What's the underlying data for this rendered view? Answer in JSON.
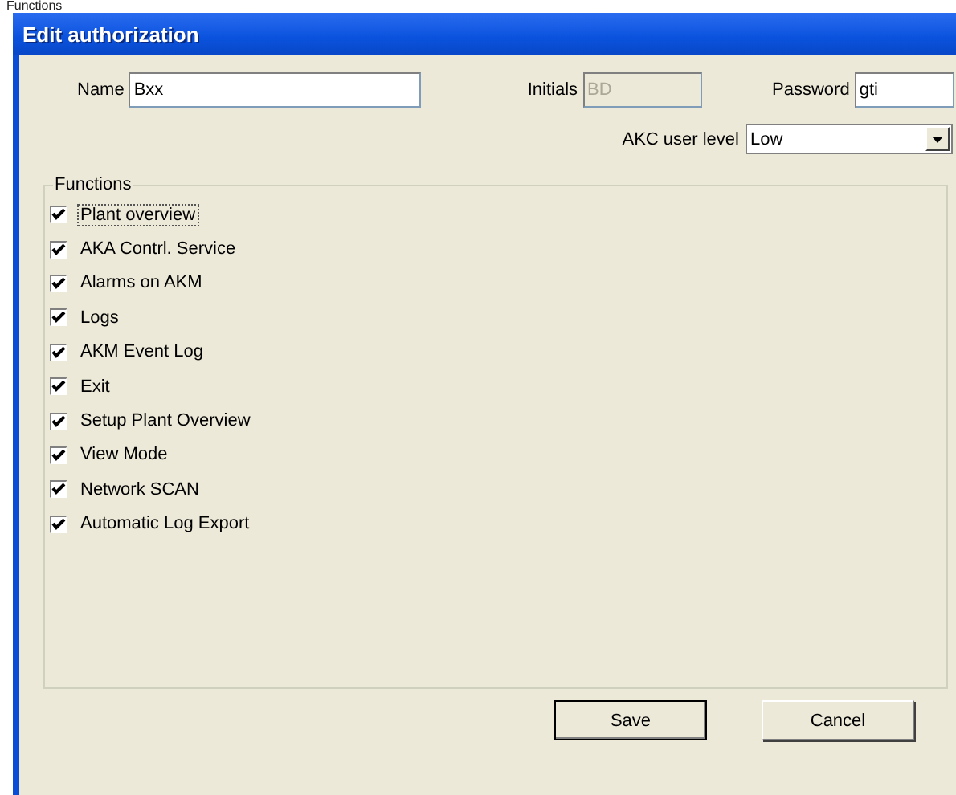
{
  "page_heading": "Functions",
  "window": {
    "title": "Edit authorization"
  },
  "fields": {
    "name": {
      "label": "Name",
      "value": "Bxx"
    },
    "initials": {
      "label": "Initials",
      "value": "BD",
      "disabled": true
    },
    "password": {
      "label": "Password",
      "value": "gti"
    },
    "user_level": {
      "label": "AKC user level",
      "value": "Low"
    }
  },
  "functions": {
    "title": "Functions",
    "items": [
      {
        "label": "Plant overview",
        "checked": true,
        "focused": true
      },
      {
        "label": "AKA Contrl. Service",
        "checked": true,
        "focused": false
      },
      {
        "label": "Alarms on AKM",
        "checked": true,
        "focused": false
      },
      {
        "label": "Logs",
        "checked": true,
        "focused": false
      },
      {
        "label": "AKM Event Log",
        "checked": true,
        "focused": false
      },
      {
        "label": "Exit",
        "checked": true,
        "focused": false
      },
      {
        "label": "Setup Plant Overview",
        "checked": true,
        "focused": false
      },
      {
        "label": "View Mode",
        "checked": true,
        "focused": false
      },
      {
        "label": "Network SCAN",
        "checked": true,
        "focused": false
      },
      {
        "label": "Automatic Log Export",
        "checked": true,
        "focused": false
      }
    ]
  },
  "buttons": [
    {
      "label": "Save",
      "default": true
    },
    {
      "label": "Cancel",
      "default": false
    }
  ]
}
